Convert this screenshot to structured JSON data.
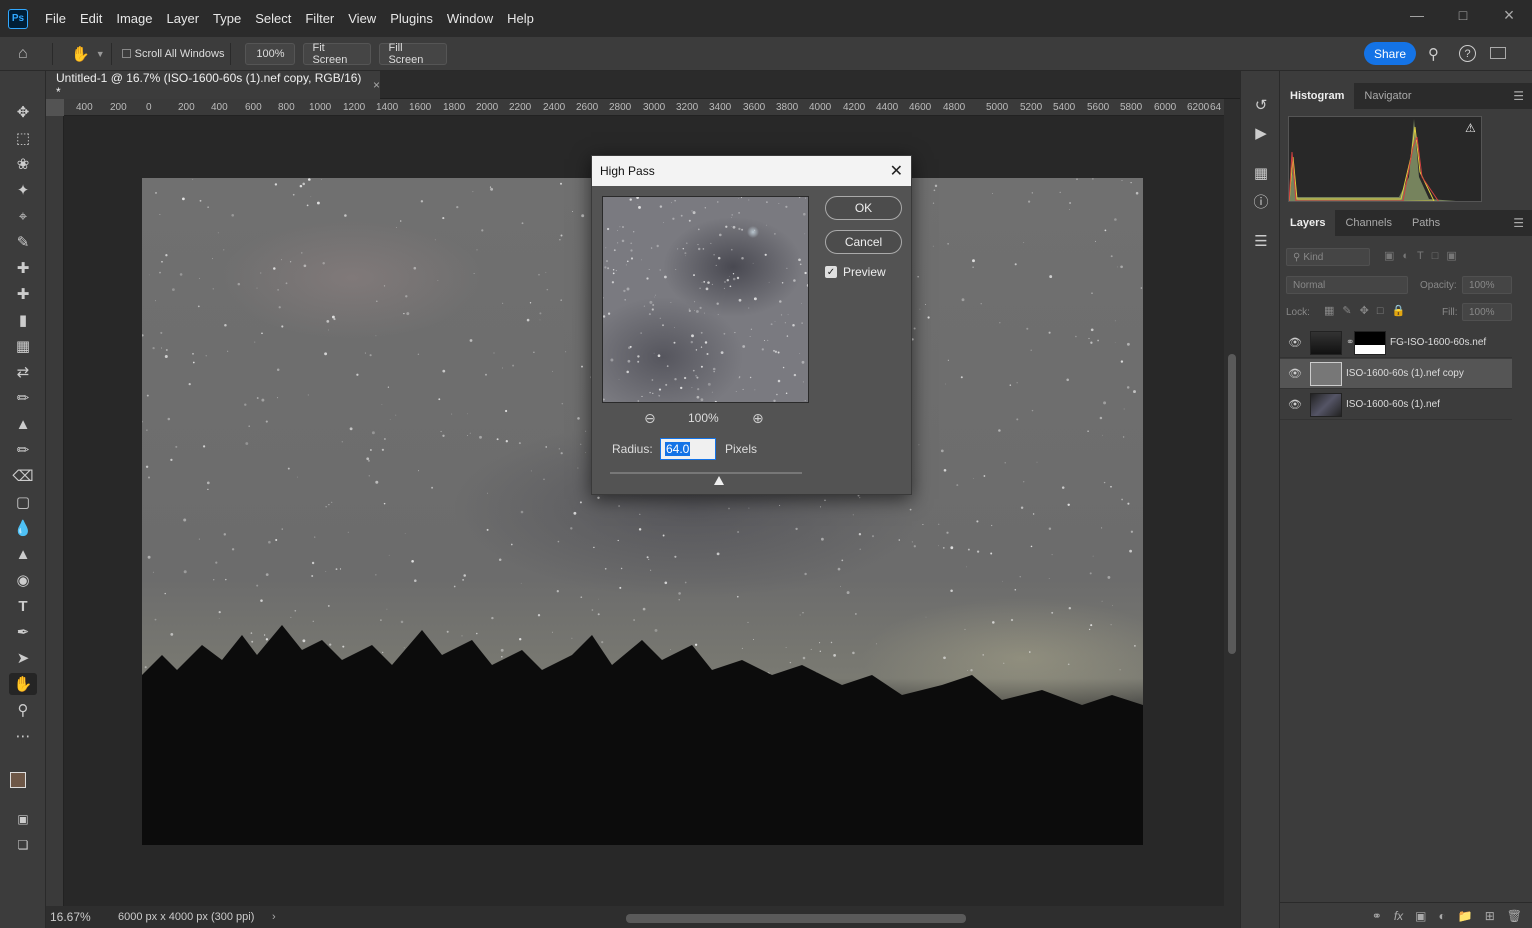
{
  "app": {
    "logo": "Ps"
  },
  "menu": [
    "File",
    "Edit",
    "Image",
    "Layer",
    "Type",
    "Select",
    "Filter",
    "View",
    "Plugins",
    "Window",
    "Help"
  ],
  "options": {
    "scroll_all": "Scroll All Windows",
    "zoom": "100%",
    "fit": "Fit Screen",
    "fill": "Fill Screen",
    "share": "Share"
  },
  "document": {
    "tab_title": "Untitled-1 @ 16.7% (ISO-1600-60s (1).nef copy, RGB/16) *",
    "close": "×"
  },
  "ruler": [
    "400",
    "200",
    "0",
    "200",
    "400",
    "600",
    "800",
    "1000",
    "1200",
    "1400",
    "1600",
    "1800",
    "2000",
    "2200",
    "2400",
    "2600",
    "2800",
    "3000",
    "3200",
    "3400",
    "3600",
    "3800",
    "4000",
    "4200",
    "4400",
    "4600",
    "4800",
    "5000",
    "5200",
    "5400",
    "5600",
    "5800",
    "6000",
    "6200",
    "64"
  ],
  "status": {
    "zoom": "16.67%",
    "dims": "6000 px x 4000 px (300 ppi)"
  },
  "dialog": {
    "title": "High Pass",
    "ok": "OK",
    "cancel": "Cancel",
    "preview_label": "Preview",
    "preview_checked": true,
    "zoom": "100%",
    "radius_label": "Radius:",
    "radius_value": "64.0",
    "units": "Pixels"
  },
  "panels": {
    "top_tabs": [
      "Histogram",
      "Navigator"
    ],
    "layer_tabs": [
      "Layers",
      "Channels",
      "Paths"
    ],
    "kind": "Kind",
    "blend": "Normal",
    "opacity_label": "Opacity:",
    "opacity": "100%",
    "lock_label": "Lock:",
    "fill_label": "Fill:",
    "fill": "100%",
    "layers": [
      {
        "name": "FG-ISO-1600-60s.nef",
        "selected": false
      },
      {
        "name": "ISO-1600-60s (1).nef copy",
        "selected": true
      },
      {
        "name": "ISO-1600-60s (1).nef",
        "selected": false
      }
    ]
  }
}
